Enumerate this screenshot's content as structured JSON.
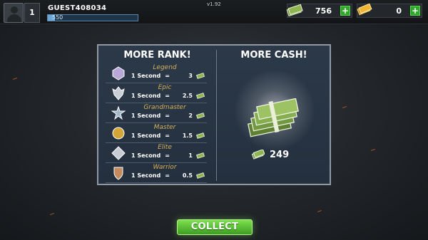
{
  "header": {
    "level": "1",
    "player_name": "GUEST408034",
    "xp_text": "550",
    "xp_progress": 0.08,
    "version": "v1.92",
    "cash_amount": "756",
    "gold_amount": "0",
    "add_label": "+"
  },
  "panel": {
    "rank_title": "MORE RANK!",
    "cash_title": "MORE CASH!",
    "per_label": "1 Second",
    "equals": "=",
    "ranks": [
      {
        "name": "Legend",
        "value": "3",
        "icon": "legend-rank-icon",
        "color": "#b9a7d8"
      },
      {
        "name": "Epic",
        "value": "2.5",
        "icon": "epic-rank-icon",
        "color": "#c9cfd6"
      },
      {
        "name": "Grandmaster",
        "value": "2",
        "icon": "grandmaster-rank-icon",
        "color": "#9fb8cc"
      },
      {
        "name": "Master",
        "value": "1.5",
        "icon": "master-rank-icon",
        "color": "#d4a637"
      },
      {
        "name": "Elite",
        "value": "1",
        "icon": "elite-rank-icon",
        "color": "#c7cdd3"
      },
      {
        "name": "Warrior",
        "value": "0.5",
        "icon": "warrior-rank-icon",
        "color": "#c58a5e"
      }
    ],
    "reward_amount": "249"
  },
  "collect_label": "COLLECT",
  "colors": {
    "accent_green": "#3b9e22",
    "rank_name_gold": "#d3b15b",
    "panel_bg": "#2c3949"
  }
}
